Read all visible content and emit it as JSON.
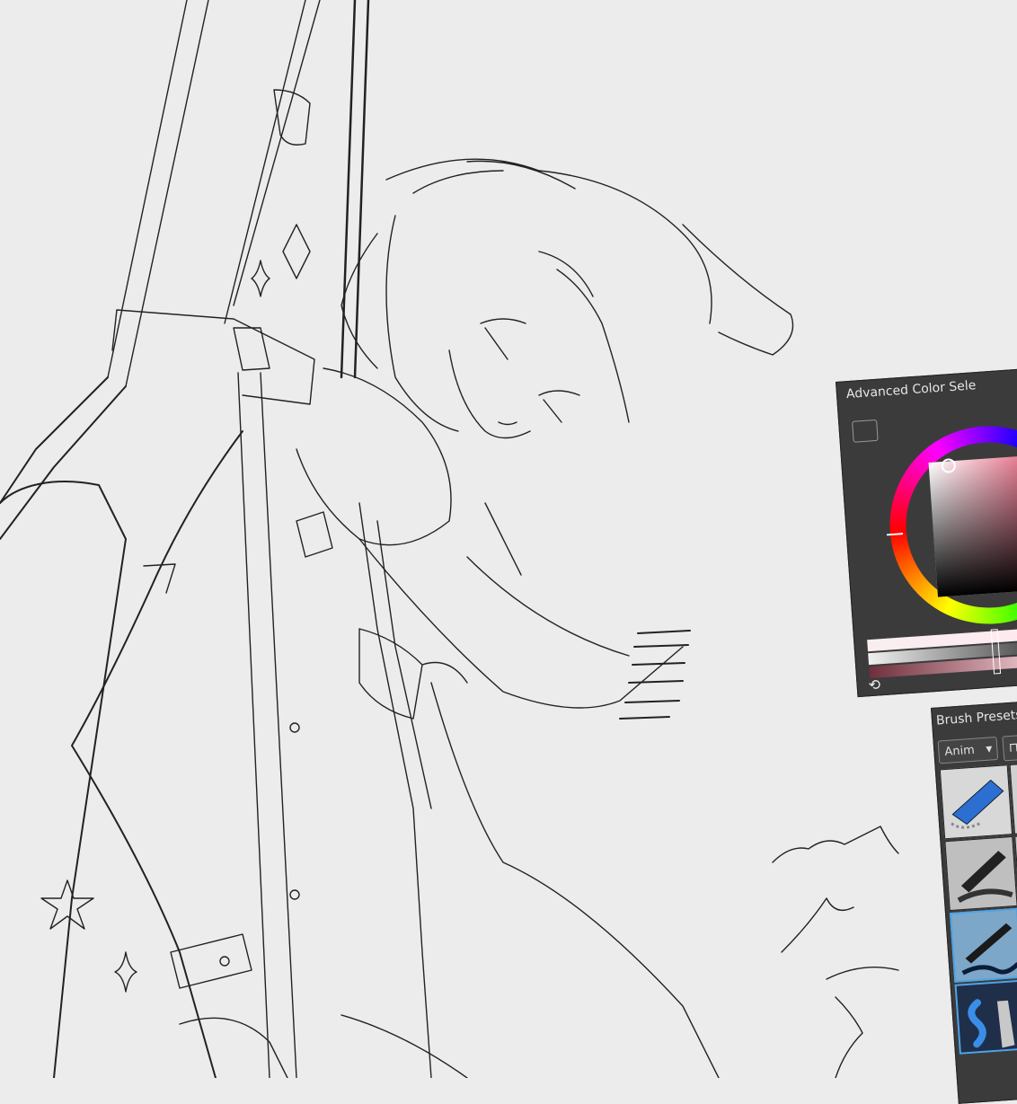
{
  "canvas": {
    "background": "#ececec",
    "line_color": "#222222"
  },
  "color_panel": {
    "title": "Advanced Color Sele",
    "menu_icon": "list-icon",
    "refresh_icon": "refresh-icon",
    "refresh_glyph": "⟲",
    "selected_color": "#e04a6a"
  },
  "brush_panel": {
    "title": "Brush Presets",
    "tag_value": "Anim",
    "bookmark_icon": "bookmark-icon",
    "bookmark_glyph": "⊓",
    "highlight_color": "#4ea3e6"
  }
}
